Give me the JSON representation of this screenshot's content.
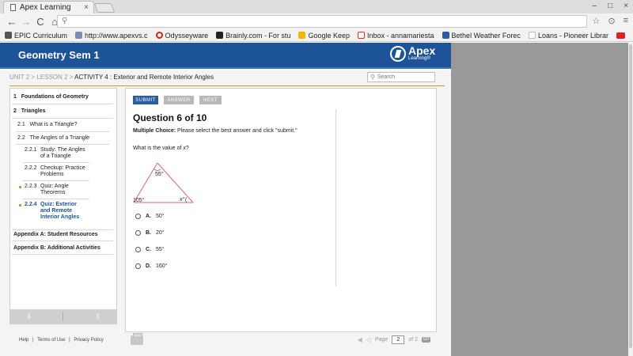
{
  "browser": {
    "tab_title": "Apex Learning",
    "tab_close": "×",
    "window_controls": [
      "–",
      "□",
      "×"
    ],
    "nav": {
      "back": "←",
      "forward": "→",
      "reload": "C",
      "home": "⌂"
    },
    "address": "",
    "toolbar_icons": [
      "☆",
      "⊙",
      "≡"
    ],
    "bookmarks": [
      {
        "label": "EPIC Curriculum",
        "color": "#555555"
      },
      {
        "label": "http://www.apexvs.c",
        "color": "#7a8fb0"
      },
      {
        "label": "Odysseyware",
        "color": "#cc2222"
      },
      {
        "label": "Brainly.com - For stu",
        "color": "#222222"
      },
      {
        "label": "Google Keep",
        "color": "#f2b800"
      },
      {
        "label": "Inbox - annamariesta",
        "color": "#cc3333"
      },
      {
        "label": "Bethel Weather Forec",
        "color": "#2a5ea0"
      },
      {
        "label": "Loans - Pioneer Librar",
        "color": "#dddddd"
      },
      {
        "label": "",
        "color": "#e02020"
      }
    ]
  },
  "header": {
    "course_title": "Geometry Sem 1",
    "logo_name": "Apex",
    "logo_sub": "Learning®"
  },
  "breadcrumb": {
    "unit": "UNIT 2",
    "sep": " > ",
    "lesson": "LESSON 2",
    "current": "ACTIVITY 4 : Exterior and Remote Interior Angles"
  },
  "search": {
    "placeholder": "Search"
  },
  "sidebar": {
    "items": [
      {
        "num": "1",
        "label": "Foundations of Geometry"
      },
      {
        "num": "2",
        "label": "Triangles"
      },
      {
        "num": "2.1",
        "label": "What is a Triangle?"
      },
      {
        "num": "2.2",
        "label": "The Angles of a Triangle"
      },
      {
        "num": "2.2.1",
        "label": "Study: The Angles of a Triangle"
      },
      {
        "num": "2.2.2",
        "label": "Checkup: Practice Problems"
      },
      {
        "num": "2.2.3",
        "label": "Quiz: Angle Theorems"
      },
      {
        "num": "2.2.4",
        "label": "Quiz: Exterior and Remote Interior Angles"
      },
      {
        "num": "",
        "label": "Appendix A: Student Resources"
      },
      {
        "num": "",
        "label": "Appendix B: Additional Activities"
      }
    ],
    "up_arrow": "⇩",
    "down_arrow": "⇧"
  },
  "footer_links": [
    "Help",
    "|",
    "Terms of Use",
    "|",
    "Privacy Policy"
  ],
  "question": {
    "buttons": {
      "submit": "SUBMIT",
      "answer": "ANSWER",
      "next": "NEXT"
    },
    "title": "Question 6 of 10",
    "instruction_bold": "Multiple Choice:",
    "instruction_rest": " Please select the best answer and click \"submit.\"",
    "prompt_start": "What is the value of ",
    "prompt_var": "x",
    "prompt_end": "?",
    "figure_labels": {
      "top": "55°",
      "exterior": "105°",
      "var": "x°"
    },
    "options": [
      {
        "letter": "A.",
        "value": "50°"
      },
      {
        "letter": "B.",
        "value": "20°"
      },
      {
        "letter": "C.",
        "value": "55°"
      },
      {
        "letter": "D.",
        "value": "160°"
      }
    ]
  },
  "pager": {
    "label": "Page",
    "current": "2",
    "of": "of 2",
    "go": "GO"
  }
}
